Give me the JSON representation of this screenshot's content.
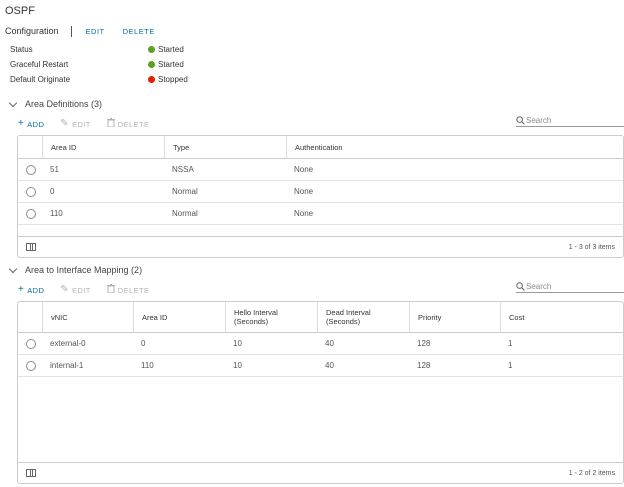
{
  "page": {
    "title": "OSPF"
  },
  "config": {
    "label": "Configuration",
    "edit": "EDIT",
    "delete": "DELETE"
  },
  "status": [
    {
      "key": "Status",
      "value": "Started",
      "state": "green"
    },
    {
      "key": "Graceful Restart",
      "value": "Started",
      "state": "green"
    },
    {
      "key": "Default Originate",
      "value": "Stopped",
      "state": "red"
    }
  ],
  "colors": {
    "accent": "#0072a3",
    "started": "#5aa220",
    "stopped": "#e12200",
    "disabled": "#b3b3b3"
  },
  "area_definitions": {
    "title": "Area Definitions (3)",
    "toolbar": {
      "add": "ADD",
      "edit": "EDIT",
      "delete": "DELETE"
    },
    "search_placeholder": "Search",
    "columns": [
      "Area ID",
      "Type",
      "Authentication"
    ],
    "rows": [
      [
        "51",
        "NSSA",
        "None"
      ],
      [
        "0",
        "Normal",
        "None"
      ],
      [
        "110",
        "Normal",
        "None"
      ]
    ],
    "footer": "1 - 3 of 3 items"
  },
  "interface_mapping": {
    "title": "Area to Interface Mapping (2)",
    "toolbar": {
      "add": "ADD",
      "edit": "EDIT",
      "delete": "DELETE"
    },
    "search_placeholder": "Search",
    "columns": [
      {
        "line1": "vNIC",
        "line2": ""
      },
      {
        "line1": "Area ID",
        "line2": ""
      },
      {
        "line1": "Hello Interval",
        "line2": "(Seconds)"
      },
      {
        "line1": "Dead Interval",
        "line2": "(Seconds)"
      },
      {
        "line1": "Priority",
        "line2": ""
      },
      {
        "line1": "Cost",
        "line2": ""
      }
    ],
    "rows": [
      [
        "external-0",
        "0",
        "10",
        "40",
        "128",
        "1"
      ],
      [
        "internal-1",
        "110",
        "10",
        "40",
        "128",
        "1"
      ]
    ],
    "footer": "1 - 2 of 2 items"
  },
  "icons": [
    "plus-icon",
    "pencil-icon",
    "trash-icon",
    "search-icon",
    "chevron-down-icon",
    "column-toggle-icon"
  ]
}
